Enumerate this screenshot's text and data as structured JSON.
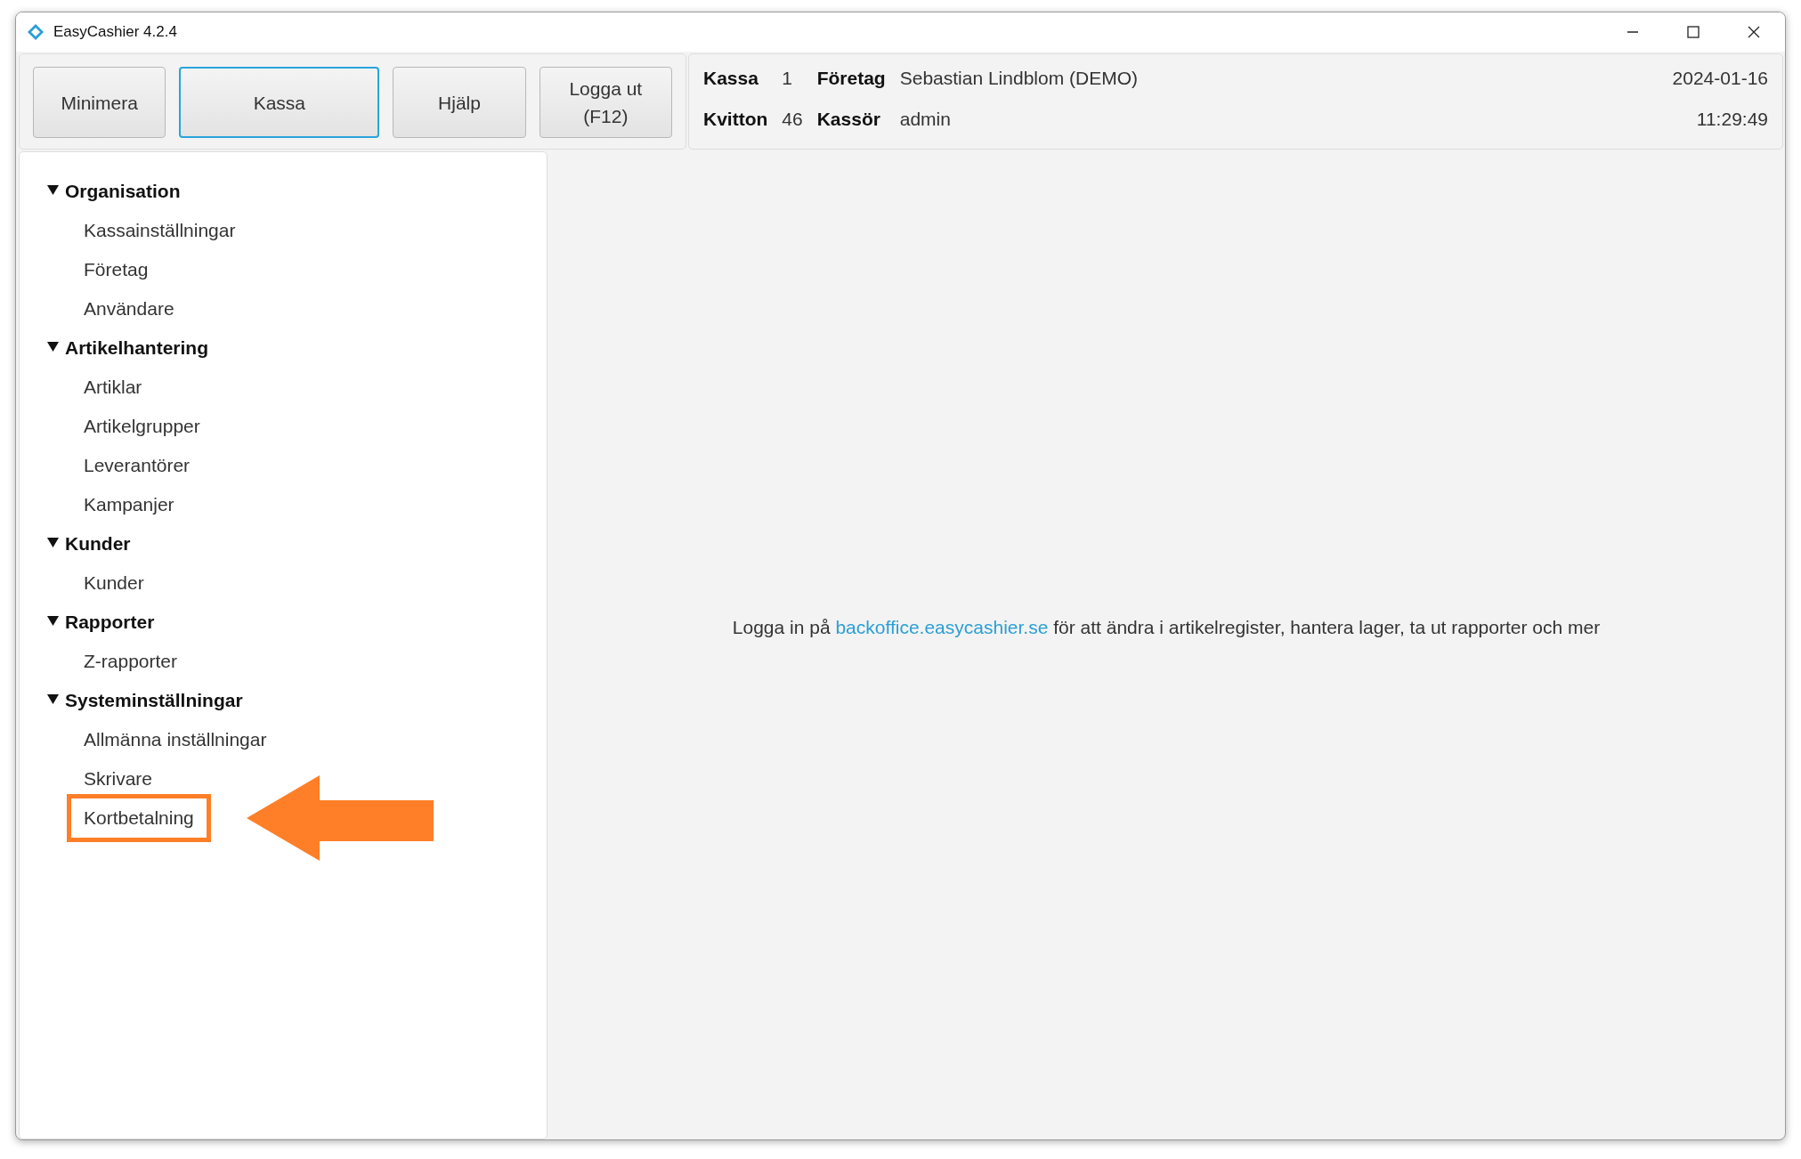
{
  "window": {
    "title": "EasyCashier 4.2.4"
  },
  "toolbar": {
    "buttons": [
      {
        "label": "Minimera",
        "focused": false
      },
      {
        "label": "Kassa",
        "focused": true
      },
      {
        "label": "Hjälp",
        "focused": false
      },
      {
        "label": "Logga ut\n(F12)",
        "focused": false
      }
    ]
  },
  "info": {
    "fields": [
      {
        "label": "Kassa",
        "value": "1"
      },
      {
        "label": "Företag",
        "value": "Sebastian Lindblom (DEMO)"
      },
      {
        "label": "Kvitton",
        "value": "46"
      },
      {
        "label": "Kassör",
        "value": "admin"
      }
    ],
    "date": "2024-01-16",
    "time": "11:29:49"
  },
  "sidebar": {
    "sections": [
      {
        "label": "Organisation",
        "expanded": true,
        "children": [
          {
            "label": "Kassainställningar",
            "highlighted": false
          },
          {
            "label": "Företag",
            "highlighted": false
          },
          {
            "label": "Användare",
            "highlighted": false
          }
        ]
      },
      {
        "label": "Artikelhantering",
        "expanded": true,
        "children": [
          {
            "label": "Artiklar",
            "highlighted": false
          },
          {
            "label": "Artikelgrupper",
            "highlighted": false
          },
          {
            "label": "Leverantörer",
            "highlighted": false
          },
          {
            "label": "Kampanjer",
            "highlighted": false
          }
        ]
      },
      {
        "label": "Kunder",
        "expanded": true,
        "children": [
          {
            "label": "Kunder",
            "highlighted": false
          }
        ]
      },
      {
        "label": "Rapporter",
        "expanded": true,
        "children": [
          {
            "label": "Z-rapporter",
            "highlighted": false
          }
        ]
      },
      {
        "label": "Systeminställningar",
        "expanded": true,
        "children": [
          {
            "label": "Allmänna inställningar",
            "highlighted": false
          },
          {
            "label": "Skrivare",
            "highlighted": false
          },
          {
            "label": "Kortbetalning",
            "highlighted": true
          }
        ]
      }
    ]
  },
  "message": {
    "before": "Logga in på",
    "link": "backoffice.easycashier.se",
    "after": "för att ändra i artikelregister, hantera lager, ta ut rapporter och mer"
  }
}
